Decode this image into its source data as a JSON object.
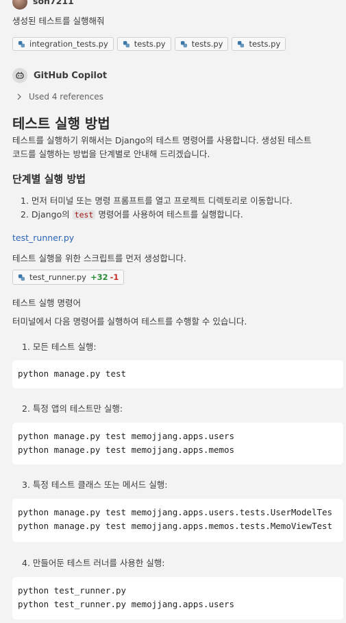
{
  "user": {
    "name": "son7211",
    "prompt": "생성된 테스트를 실행해줘"
  },
  "attachments": [
    "integration_tests.py",
    "tests.py",
    "tests.py",
    "tests.py"
  ],
  "assistant": {
    "name": "GitHub Copilot",
    "references": "Used 4 references",
    "heading": "테스트 실행 방법",
    "intro_line1": "테스트를 실행하기 위해서는 Django의 테스트 명령어를 사용합니다. 생성된 테스트",
    "intro_line2": "코드를 실행하는 방법을 단계별로 안내해 드리겠습니다.",
    "steps_heading": "단계별 실행 방법",
    "step1": "1. 먼저 터미널 또는 명령 프롬프트를 열고 프로젝트 디렉토리로 이동합니다.",
    "step2_prefix": "2. Django의 ",
    "step2_code": "test",
    "step2_suffix": " 명령어를 사용하여 테스트를 실행합니다.",
    "file_link": "test_runner.py",
    "file_desc": "테스트 실행을 위한 스크립트를 먼저 생성합니다.",
    "file_chip": {
      "name": "test_runner.py",
      "added": "+32",
      "removed": "-1"
    },
    "commands_heading": "테스트 실행 명령어",
    "commands_desc": "터미널에서 다음 명령어를 실행하여 테스트를 수행할 수 있습니다.",
    "items": [
      {
        "label": "1. 모든 테스트 실행:",
        "code": [
          "python manage.py test"
        ]
      },
      {
        "label": "2. 특정 앱의 테스트만 실행:",
        "code": [
          "python manage.py test memojjang.apps.users",
          "python manage.py test memojjang.apps.memos"
        ]
      },
      {
        "label": "3. 특정 테스트 클래스 또는 메서드 실행:",
        "code": [
          "python manage.py test memojjang.apps.users.tests.UserModelTes",
          "python manage.py test memojjang.apps.memos.tests.MemoViewTest"
        ]
      },
      {
        "label": "4. 만들어둔 테스트 러너를 사용한 실행:",
        "code": [
          "python test_runner.py",
          "python test_runner.py memojjang.apps.users"
        ]
      }
    ]
  }
}
